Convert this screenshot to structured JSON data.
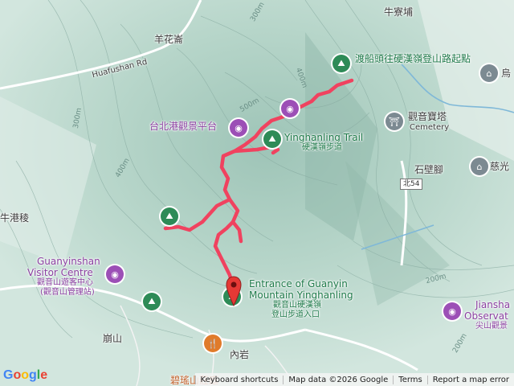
{
  "labels": {
    "niu_liao_pu": "牛寮埔",
    "yang_hua_lun": "羊花崙",
    "huafushan_rd": "Huafushan Rd",
    "start_point": "渡船頭往硬漢嶺登山路起點",
    "wu": "烏",
    "taipei_port_platform": "台北港觀景平台",
    "guanyin_tower": "觀音寶塔",
    "cemetery": "Cemetery",
    "yinghanling_trail_en": "Yinghanling Trail",
    "yinghanling_trail_zh": "硬漢嶺步道",
    "shi_bi_jiao": "石壁腳",
    "ci": "慈光",
    "road_54": "北54",
    "niu_gang_leng": "牛港稜",
    "visitor_centre_en_1": "Guanyinshan",
    "visitor_centre_en_2": "Visitor Centre",
    "visitor_centre_zh_1": "觀音山遊客中心",
    "visitor_centre_zh_2": "(觀音山管理站)",
    "entrance_en_1": "Entrance of Guanyin",
    "entrance_en_2": "Mountain Yinghanling",
    "entrance_zh_1": "觀音山硬漢嶺",
    "entrance_zh_2": "登山步道入口",
    "jiansha_en_1": "Jiansha",
    "jiansha_en_2": "Observat",
    "jiansha_zh": "尖山觀景",
    "beng_shan": "崩山",
    "nei_yan": "內岩",
    "bi_yao": "碧瑤山莊庭",
    "contour_300a": "300m",
    "contour_300b": "300m",
    "contour_400a": "400m",
    "contour_400b": "400m",
    "contour_500": "500m",
    "contour_200a": "200m",
    "contour_200b": "200m"
  },
  "footer": {
    "keyboard": "Keyboard shortcuts",
    "map_data": "Map data ©2026 Google",
    "terms": "Terms",
    "report": "Report a map error"
  },
  "logo": "Google",
  "colors": {
    "track": "#f0425f",
    "hiking_pin": "#2e8b57",
    "poi_pin": "#9c4fb6"
  },
  "icons": {
    "hiking": "hiking-icon",
    "camera": "camera-icon",
    "temple": "temple-icon",
    "restaurant": "restaurant-icon",
    "location": "location-pin-icon"
  }
}
